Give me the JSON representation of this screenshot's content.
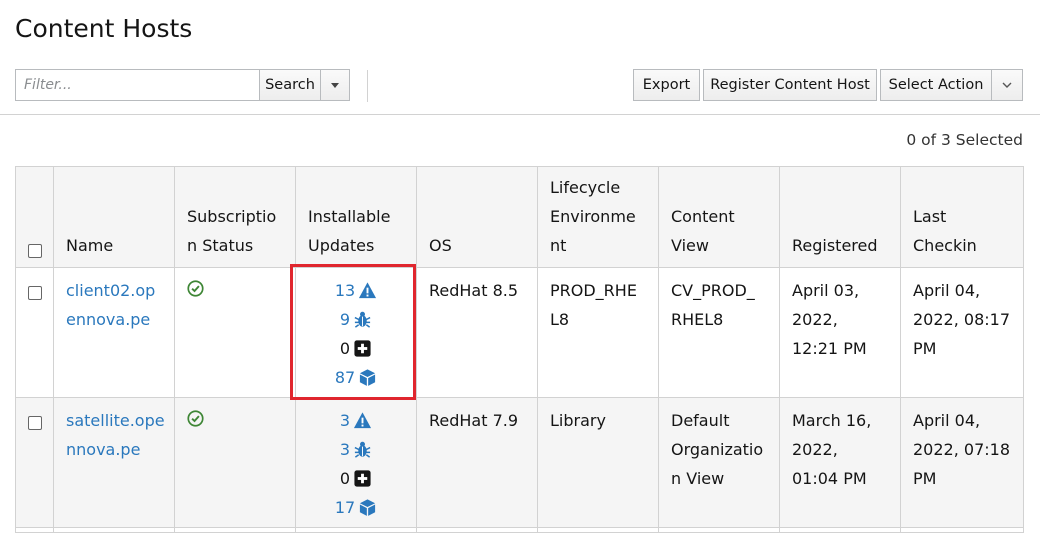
{
  "page": {
    "title": "Content Hosts"
  },
  "toolbar": {
    "filter_placeholder": "Filter...",
    "search_label": "Search",
    "export_label": "Export",
    "register_label": "Register Content Host",
    "select_action_label": "Select Action"
  },
  "selection": {
    "text": "0 of 3 Selected"
  },
  "table": {
    "headers": {
      "name": "Name",
      "subscription_status": "Subscriptio n Status",
      "installable_updates": "Installable Updates",
      "os": "OS",
      "lifecycle": "Lifecycle Environme nt",
      "content_view": "Content View",
      "registered": "Registered",
      "last_checkin": "Last Checkin"
    },
    "rows": [
      {
        "name": "client02.op ennova.pe",
        "updates": {
          "security": "13",
          "bugfix": "9",
          "enhancement": "0",
          "packages": "87"
        },
        "os": "RedHat 8.5",
        "lifecycle": "PROD_RHE L8",
        "content_view": "CV_PROD_ RHEL8",
        "registered": "April 03, 2022, 12:21 PM",
        "last_checkin": "April 04, 2022, 08:17 PM"
      },
      {
        "name": "satellite.ope nnova.pe",
        "updates": {
          "security": "3",
          "bugfix": "3",
          "enhancement": "0",
          "packages": "17"
        },
        "os": "RedHat 7.9",
        "lifecycle": "Library",
        "content_view": "Default Organizatio n View",
        "registered": "March 16, 2022, 01:04 PM",
        "last_checkin": "April 04, 2022, 07:18 PM"
      }
    ]
  },
  "colors": {
    "link": "#2a78bd",
    "success": "#3e8635",
    "highlight": "#e0262e"
  },
  "icons": {
    "subscription_ok": "check-circle-icon",
    "security": "warning-triangle-icon",
    "bugfix": "bug-icon",
    "enhancement": "plus-square-icon",
    "packages": "package-cube-icon"
  }
}
